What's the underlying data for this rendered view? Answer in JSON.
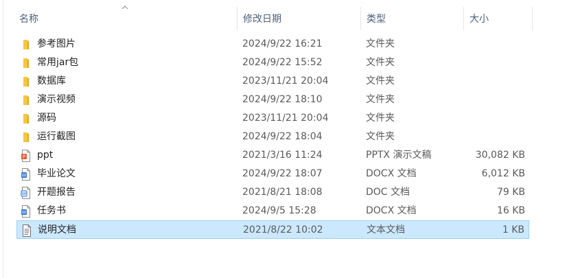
{
  "columns": {
    "name": "名称",
    "date": "修改日期",
    "type": "类型",
    "size": "大小"
  },
  "files": [
    {
      "name": "参考图片",
      "date": "2024/9/22 16:21",
      "type": "文件夹",
      "size": "",
      "icon": "folder-icon"
    },
    {
      "name": "常用jar包",
      "date": "2024/9/22 15:52",
      "type": "文件夹",
      "size": "",
      "icon": "folder-icon"
    },
    {
      "name": "数据库",
      "date": "2023/11/21 20:04",
      "type": "文件夹",
      "size": "",
      "icon": "folder-icon"
    },
    {
      "name": "演示视频",
      "date": "2024/9/22 18:10",
      "type": "文件夹",
      "size": "",
      "icon": "folder-icon"
    },
    {
      "name": "源码",
      "date": "2023/11/21 20:04",
      "type": "文件夹",
      "size": "",
      "icon": "folder-icon"
    },
    {
      "name": "运行截图",
      "date": "2024/9/22 18:04",
      "type": "文件夹",
      "size": "",
      "icon": "folder-icon"
    },
    {
      "name": "ppt",
      "date": "2021/3/16 11:24",
      "type": "PPTX 演示文稿",
      "size": "30,082 KB",
      "icon": "pptx-icon"
    },
    {
      "name": "毕业论文",
      "date": "2024/9/22 18:07",
      "type": "DOCX 文档",
      "size": "6,012 KB",
      "icon": "docx-icon"
    },
    {
      "name": "开题报告",
      "date": "2021/8/21 18:08",
      "type": "DOC 文档",
      "size": "79 KB",
      "icon": "doc-icon"
    },
    {
      "name": "任务书",
      "date": "2024/9/5 15:28",
      "type": "DOCX 文档",
      "size": "16 KB",
      "icon": "docx-icon"
    },
    {
      "name": "说明文档",
      "date": "2021/8/22 10:02",
      "type": "文本文档",
      "size": "1 KB",
      "icon": "txt-icon",
      "selected": true
    }
  ],
  "colors": {
    "folder": "#f8c63d",
    "pptx": "#e3592d",
    "docx": "#2b6fd6",
    "selection": "#cce8ff",
    "selection_border": "#99d1ff",
    "header_text": "#4c607a"
  }
}
